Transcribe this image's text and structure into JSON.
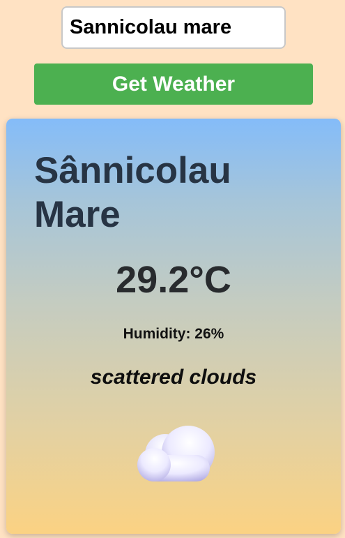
{
  "search": {
    "value": "Sannicolau mare"
  },
  "actions": {
    "get_weather_label": "Get Weather"
  },
  "weather": {
    "city": "Sânnicolau Mare",
    "temperature": "29.2°C",
    "humidity": "Humidity: 26%",
    "description": "scattered clouds",
    "icon": "cloud-icon"
  },
  "colors": {
    "page_background": "#ffe2c3",
    "button_background": "#4cb050",
    "card_gradient_top": "#84bcf9",
    "card_gradient_bottom": "#fbd283",
    "city_text": "#273444"
  }
}
